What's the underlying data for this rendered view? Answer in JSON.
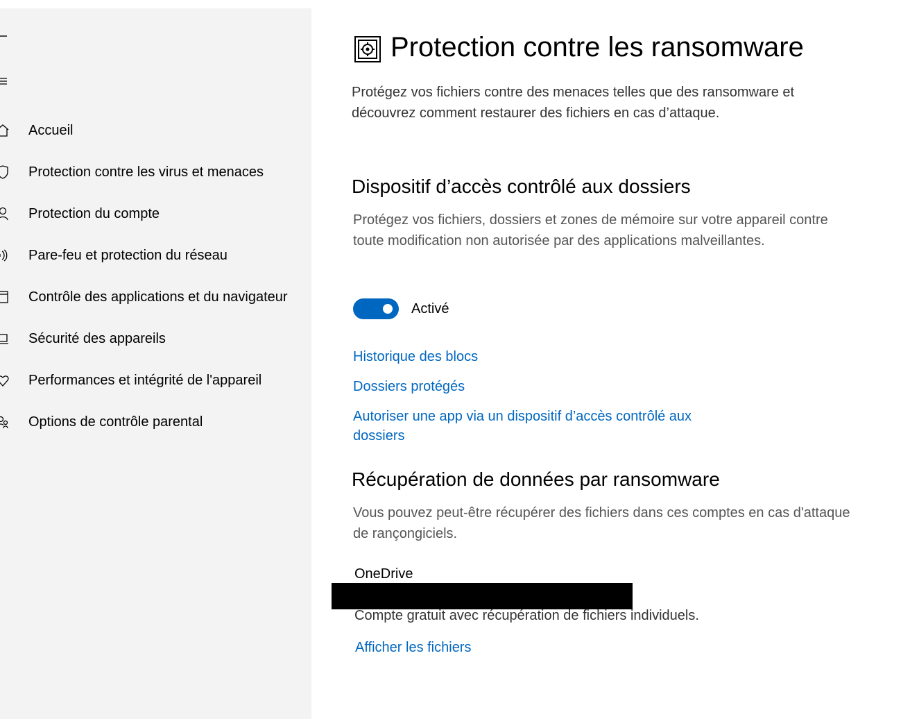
{
  "sidebar": {
    "items": [
      {
        "label": "Accueil",
        "icon": "home-icon"
      },
      {
        "label": "Protection contre les virus et menaces",
        "icon": "shield-icon"
      },
      {
        "label": "Protection du compte",
        "icon": "person-icon"
      },
      {
        "label": "Pare-feu et protection du réseau",
        "icon": "wifi-icon"
      },
      {
        "label": "Contrôle des applications et du navigateur",
        "icon": "app-window-icon"
      },
      {
        "label": "Sécurité des appareils",
        "icon": "laptop-icon"
      },
      {
        "label": "Performances et intégrité de l'appareil",
        "icon": "heart-icon"
      },
      {
        "label": "Options de contrôle parental",
        "icon": "family-icon"
      }
    ]
  },
  "main": {
    "title": "Protection contre les ransomware",
    "title_icon": "ransomware-vault-icon",
    "description": "Protégez vos fichiers contre des menaces telles que des ransomware et découvrez comment restaurer des fichiers en cas d’attaque.",
    "cfa": {
      "title": "Dispositif d’accès contrôlé aux dossiers",
      "description": "Protégez vos fichiers, dossiers et zones de mémoire sur votre appareil contre toute modification non autorisée par des applications malveillantes.",
      "toggle_on": true,
      "toggle_label": "Activé",
      "links": [
        "Historique des blocs",
        "Dossiers protégés",
        "Autoriser une app via un dispositif d’accès contrôlé aux dossiers"
      ]
    },
    "recovery": {
      "title": "Récupération de données par ransomware",
      "description": "Vous pouvez peut-être récupérer des fichiers dans ces comptes en cas d'attaque de rançongiciels.",
      "provider": "OneDrive",
      "account_desc": "Compte gratuit avec récupération de fichiers individuels.",
      "view_files_link": "Afficher les fichiers"
    }
  },
  "colors": {
    "accent": "#0067c0",
    "sidebar_bg": "#f3f3f3",
    "redaction": "#000000"
  }
}
